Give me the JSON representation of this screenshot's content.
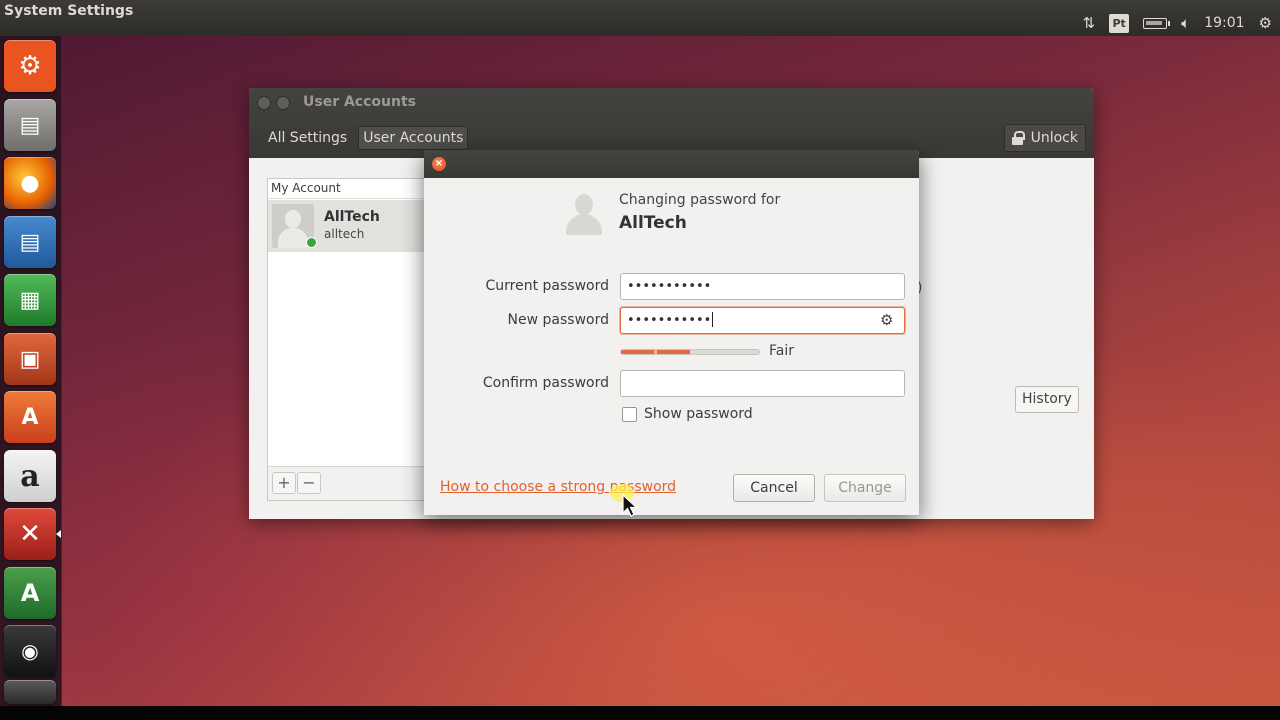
{
  "top_panel": {
    "app_title": "System Settings",
    "indicators": {
      "network_icon": "updown-arrows-icon",
      "keyboard_layout": "Pt",
      "battery_icon": "battery-icon",
      "volume_icon": "speaker-icon",
      "clock": "19:01",
      "settings_icon": "gear-icon"
    }
  },
  "launcher": {
    "items": [
      {
        "name": "Dash Home",
        "icon": "ubuntu-logo-icon",
        "color": "#e95420"
      },
      {
        "name": "Files",
        "icon": "file-cabinet-icon",
        "color": "#8a8a86"
      },
      {
        "name": "Firefox",
        "icon": "firefox-icon",
        "color": "#e66000"
      },
      {
        "name": "LibreOffice Writer",
        "icon": "writer-icon",
        "color": "#2a6aaa"
      },
      {
        "name": "LibreOffice Calc",
        "icon": "calc-icon",
        "color": "#2f9b3a"
      },
      {
        "name": "LibreOffice Impress",
        "icon": "impress-icon",
        "color": "#c44a1e"
      },
      {
        "name": "Ubuntu Software Center",
        "icon": "shopping-bag-icon",
        "color": "#e95a1c"
      },
      {
        "name": "Amazon",
        "icon": "amazon-icon",
        "color": "#3a3a3a"
      },
      {
        "name": "System Settings",
        "icon": "settings-tools-icon",
        "color": "#c0392b"
      },
      {
        "name": "Software Updater",
        "icon": "updater-icon",
        "color": "#3a8a3a"
      },
      {
        "name": "Disk",
        "icon": "disk-icon",
        "color": "#2a2a2a"
      }
    ]
  },
  "main_window": {
    "title": "User Accounts",
    "breadcrumbs": [
      "All Settings",
      "User Accounts"
    ],
    "unlock_label": "Unlock",
    "accounts_header": "My Account",
    "account": {
      "full_name": "AllTech",
      "username": "alltech"
    },
    "add_button": "+",
    "remove_button": "−",
    "history_button": "History",
    "partial_text": ")"
  },
  "dialog": {
    "changing_label": "Changing password for",
    "user": "AllTech",
    "current_password": {
      "label": "Current password",
      "value": "•••••••••••"
    },
    "new_password": {
      "label": "New password",
      "value": "•••••••••••"
    },
    "strength": {
      "label": "Fair",
      "level": 0.5
    },
    "confirm_password": {
      "label": "Confirm password",
      "value": ""
    },
    "show_password": {
      "label": "Show password",
      "checked": false
    },
    "help_link": "How to choose a strong password",
    "cancel_button": "Cancel",
    "change_button": "Change"
  }
}
